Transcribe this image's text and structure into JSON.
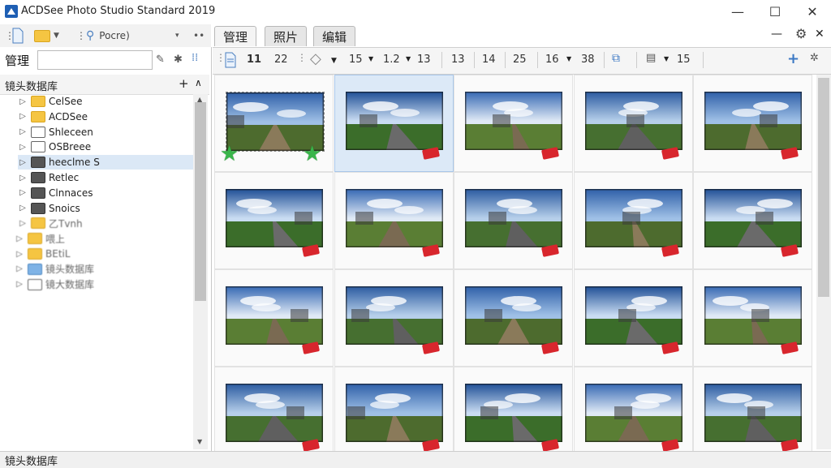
{
  "window": {
    "title": "ACDSee Photo Studio Standard 2019",
    "minimize": "—",
    "maximize": "☐",
    "close": "✕"
  },
  "left_toolbar": {
    "search_label": "Pocre)"
  },
  "left_panel": {
    "management_label": "管理",
    "database_header": "镜头数据库",
    "database_add": "+",
    "database_collapse": "∧",
    "tree_items": [
      {
        "label": "CelSee",
        "folder": "y"
      },
      {
        "label": "ACDSee",
        "folder": "y"
      },
      {
        "label": "Shleceen",
        "folder": "w"
      },
      {
        "label": "OSBreee",
        "folder": "w"
      },
      {
        "label": "heeclme S",
        "folder": "d"
      },
      {
        "label": "Retlec",
        "folder": "d"
      },
      {
        "label": "Clnnaces",
        "folder": "d"
      },
      {
        "label": "Snoics",
        "folder": "d"
      },
      {
        "label": "乙Tvnh",
        "folder": "y"
      },
      {
        "label": "喂上",
        "folder": "y"
      },
      {
        "label": "BEtiL",
        "folder": "y"
      },
      {
        "label": "镜头数据库",
        "folder": "b"
      },
      {
        "label": "镜大数据库",
        "folder": "w"
      }
    ]
  },
  "tabs": [
    {
      "label": "管理",
      "active": true
    },
    {
      "label": "照片",
      "active": false
    },
    {
      "label": "编辑",
      "active": false
    }
  ],
  "main_toolbar": {
    "items": [
      "11",
      "22",
      "15",
      "1.2",
      "13",
      "13",
      "14",
      "25",
      "16",
      "38",
      "15"
    ],
    "add": "+"
  },
  "status": {
    "text": "镜头数据库"
  },
  "colors": {
    "selection": "#dce9f7",
    "tag": "#d8262d",
    "star": "#39b54a"
  },
  "grid": {
    "rows": 4,
    "columns": 5,
    "first_item_rating_stars": 2
  }
}
